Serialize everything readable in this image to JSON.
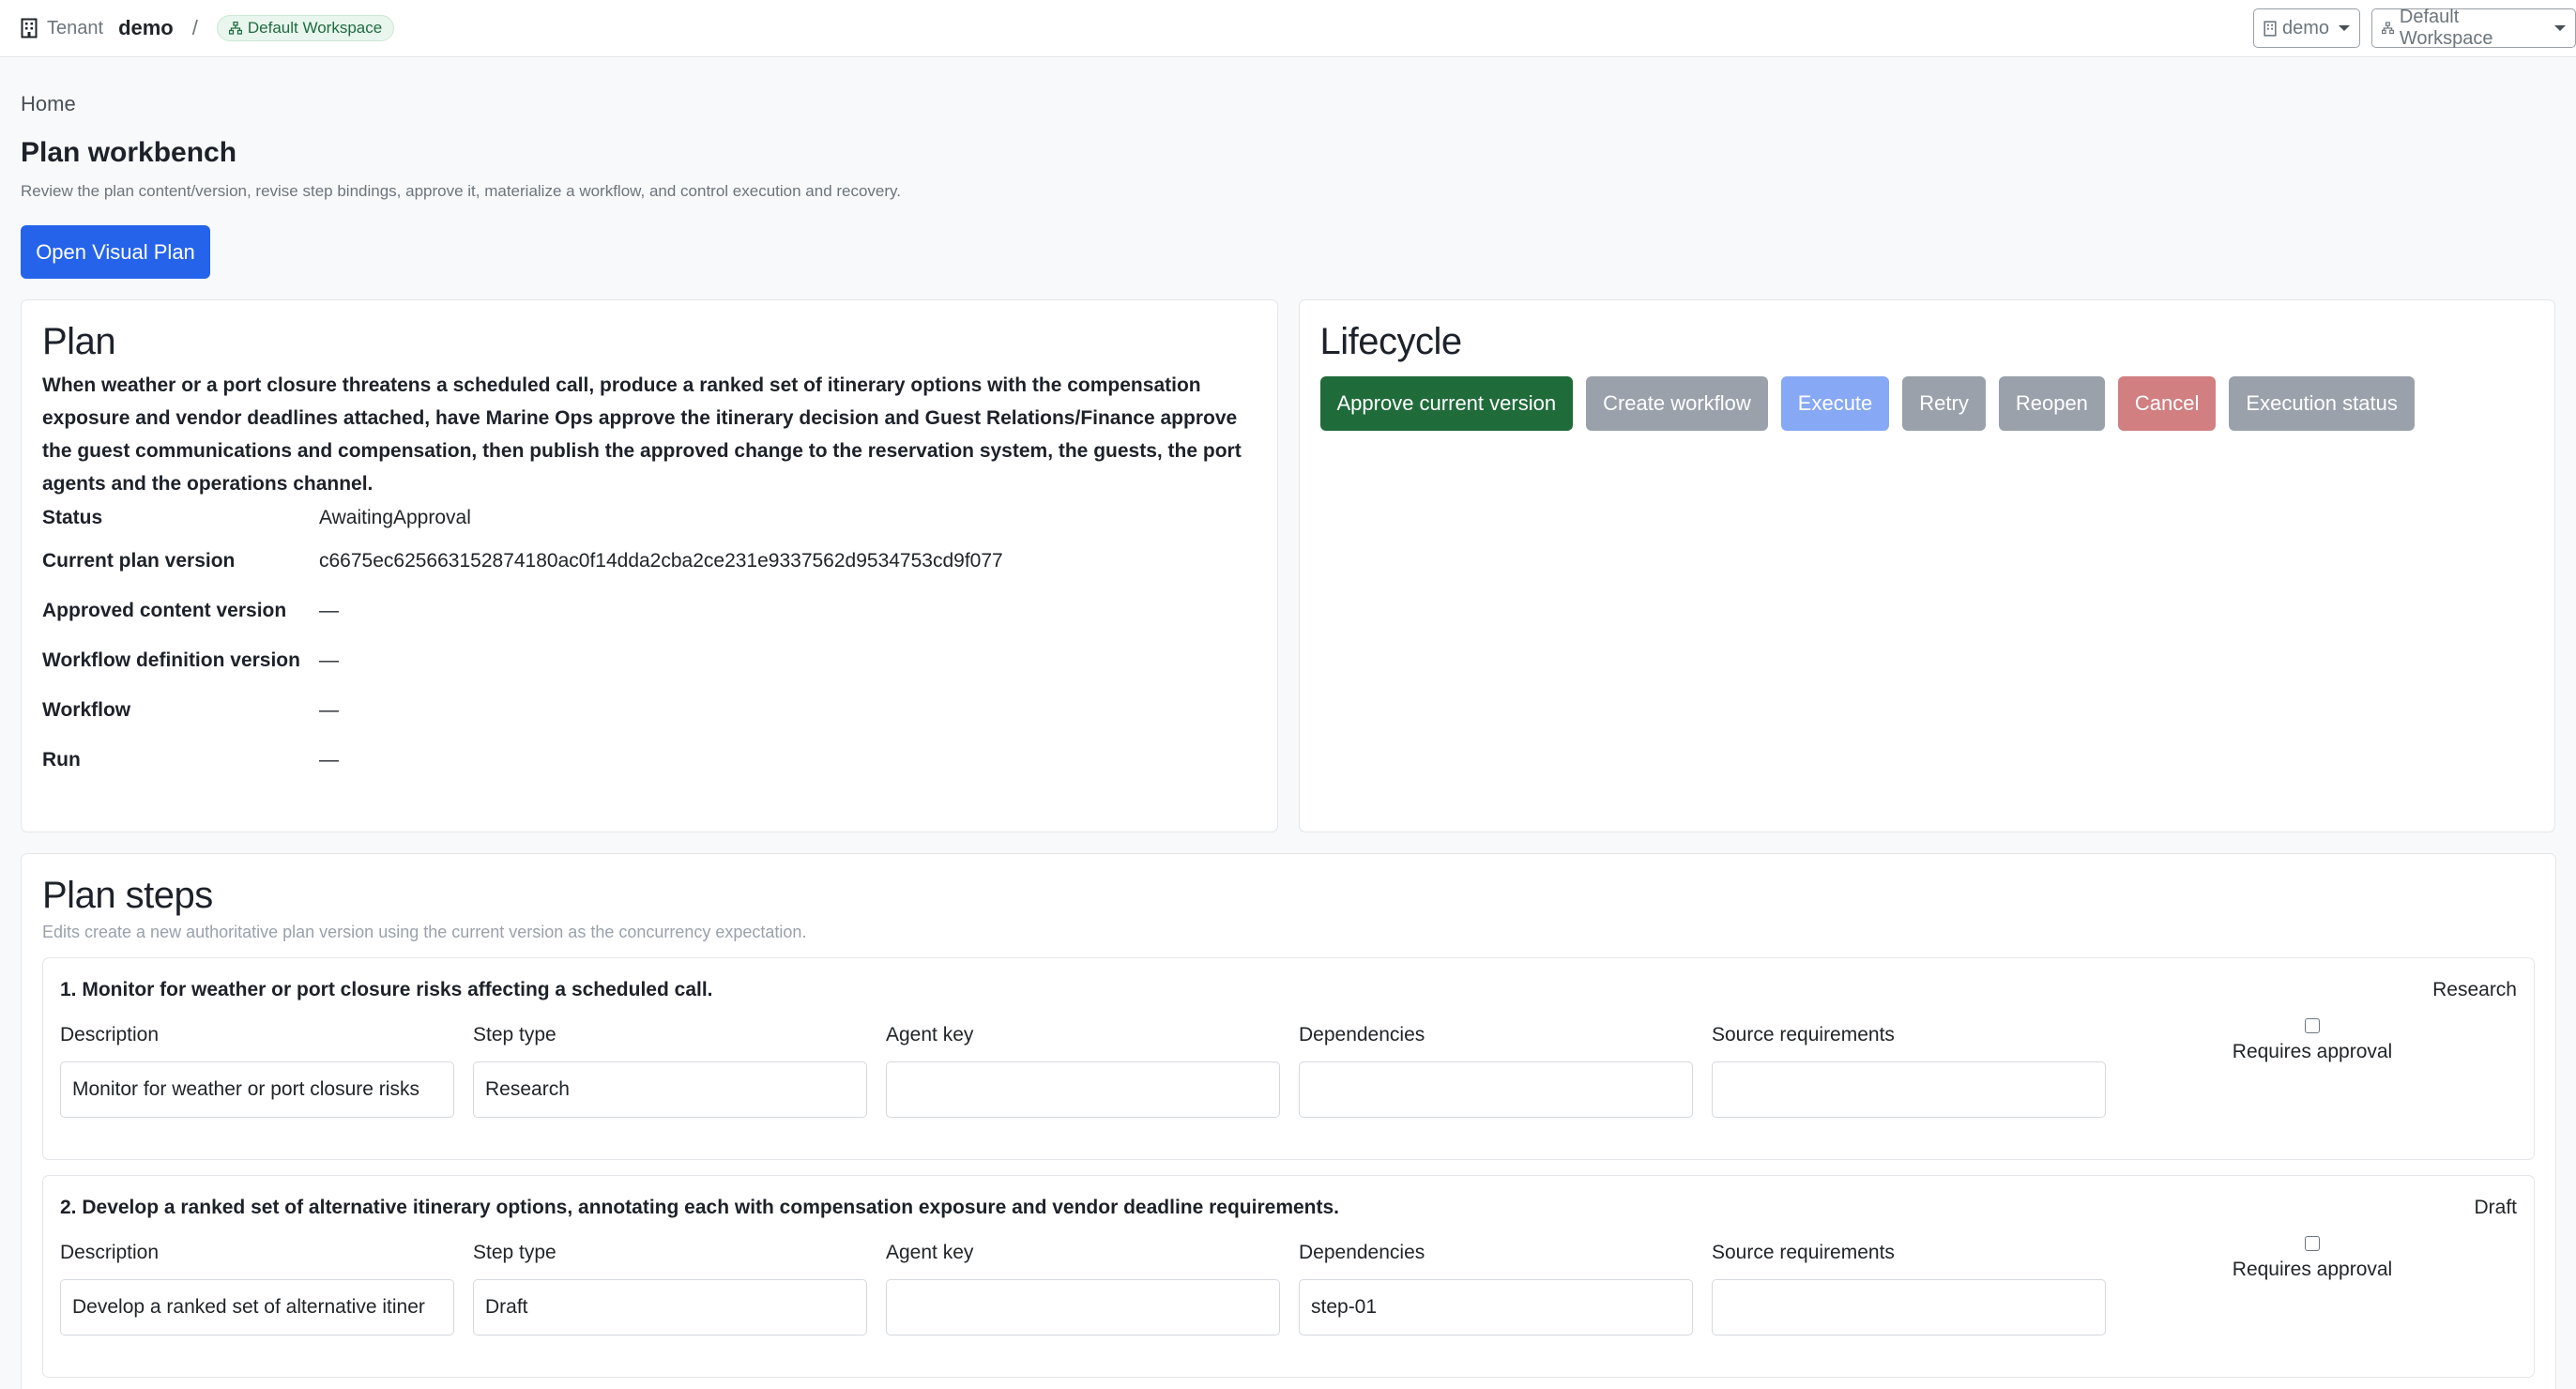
{
  "topbar": {
    "tenant_label": "Tenant",
    "tenant_name": "demo",
    "separator": "/",
    "workspace_badge": "Default Workspace",
    "tenant_select": "demo",
    "workspace_select": "Default Workspace"
  },
  "breadcrumb": {
    "home": "Home"
  },
  "page": {
    "title": "Plan workbench",
    "subtitle": "Review the plan content/version, revise step bindings, approve it, materialize a workflow, and control execution and recovery.",
    "open_visual_plan": "Open Visual Plan"
  },
  "plan": {
    "heading": "Plan",
    "description": "When weather or a port closure threatens a scheduled call, produce a ranked set of itinerary options with the compensation exposure and vendor deadlines attached, have Marine Ops approve the itinerary decision and Guest Relations/Finance approve the guest communications and compensation, then publish the approved change to the reservation system, the guests, the port agents and the operations channel.",
    "fields": [
      {
        "key": "Status",
        "value": "AwaitingApproval"
      },
      {
        "key": "Current plan version",
        "value": "c6675ec625663152874180ac0f14dda2cba2ce231e9337562d9534753cd9f077"
      },
      {
        "key": "Approved content version",
        "value": "—"
      },
      {
        "key": "Workflow definition version",
        "value": "—"
      },
      {
        "key": "Workflow",
        "value": "—"
      },
      {
        "key": "Run",
        "value": "—"
      }
    ]
  },
  "lifecycle": {
    "heading": "Lifecycle",
    "buttons": {
      "approve": "Approve current version",
      "create_workflow": "Create workflow",
      "execute": "Execute",
      "retry": "Retry",
      "reopen": "Reopen",
      "cancel": "Cancel",
      "execution_status": "Execution status"
    }
  },
  "steps": {
    "heading": "Plan steps",
    "subtitle": "Edits create a new authoritative plan version using the current version as the concurrency expectation.",
    "labels": {
      "description": "Description",
      "step_type": "Step type",
      "agent_key": "Agent key",
      "dependencies": "Dependencies",
      "source_requirements": "Source requirements",
      "requires_approval": "Requires approval"
    },
    "items": [
      {
        "title": "1. Monitor for weather or port closure risks affecting a scheduled call.",
        "type_tag": "Research",
        "description": "Monitor for weather or port closure risks",
        "step_type": "Research",
        "agent_key": "",
        "dependencies": "",
        "source_requirements": ""
      },
      {
        "title": "2. Develop a ranked set of alternative itinerary options, annotating each with compensation exposure and vendor deadline requirements.",
        "type_tag": "Draft",
        "description": "Develop a ranked set of alternative itiner",
        "step_type": "Draft",
        "agent_key": "",
        "dependencies": "step-01",
        "source_requirements": ""
      }
    ]
  }
}
